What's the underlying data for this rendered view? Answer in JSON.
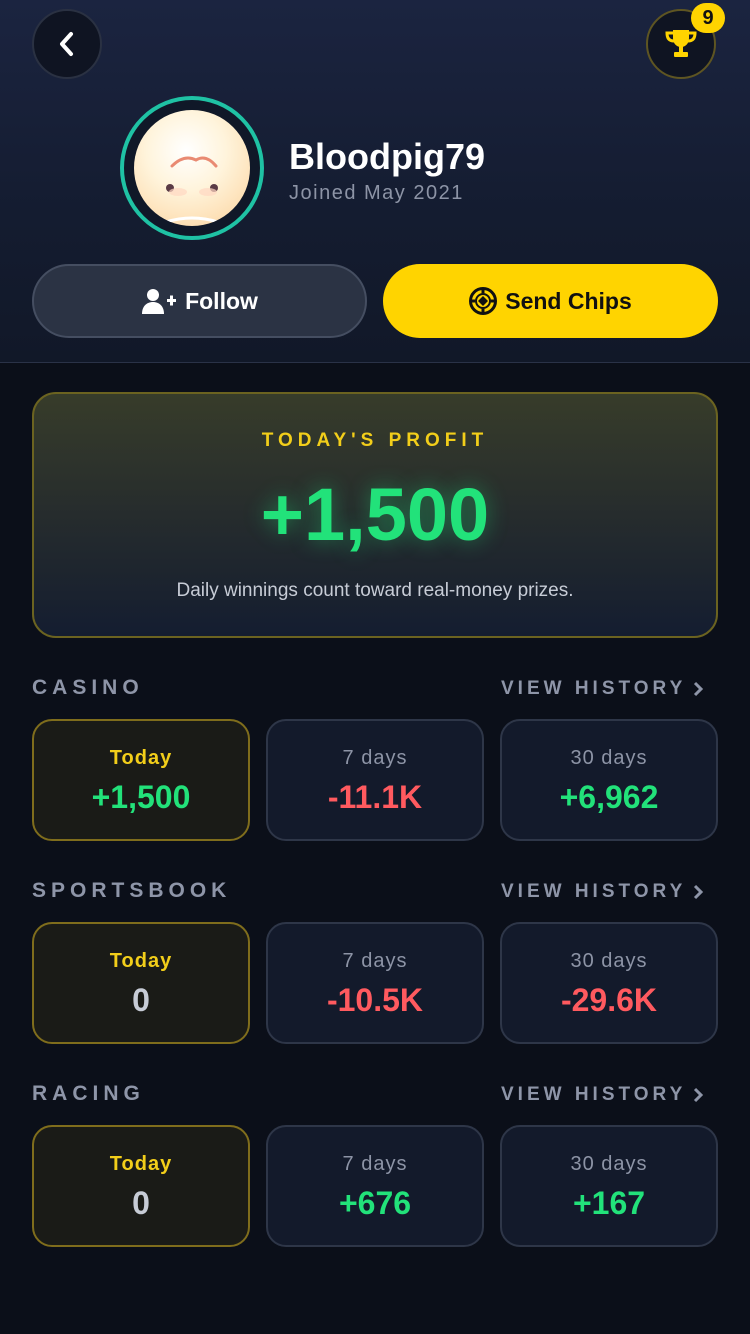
{
  "header": {
    "trophy_count": "9",
    "username": "Bloodpig79",
    "joined": "Joined May 2021",
    "follow_label": "Follow",
    "send_chips_label": "Send Chips"
  },
  "profit": {
    "label": "TODAY'S PROFIT",
    "value": "+1,500",
    "note": "Daily winnings count toward real-money prizes."
  },
  "sections": [
    {
      "title": "CASINO",
      "history_label": "VIEW HISTORY",
      "stats": [
        {
          "label": "Today",
          "value": "+1,500"
        },
        {
          "label": "7 days",
          "value": "-11.1K"
        },
        {
          "label": "30 days",
          "value": "+6,962"
        }
      ]
    },
    {
      "title": "SPORTSBOOK",
      "history_label": "VIEW HISTORY",
      "stats": [
        {
          "label": "Today",
          "value": "0"
        },
        {
          "label": "7 days",
          "value": "-10.5K"
        },
        {
          "label": "30 days",
          "value": "-29.6K"
        }
      ]
    },
    {
      "title": "RACING",
      "history_label": "VIEW HISTORY",
      "stats": [
        {
          "label": "Today",
          "value": "0"
        },
        {
          "label": "7 days",
          "value": "+676"
        },
        {
          "label": "30 days",
          "value": "+167"
        }
      ]
    }
  ],
  "colors": {
    "accent_yellow": "#ffd400",
    "positive": "#22e27a",
    "negative": "#ff5a5f",
    "avatar_ring": "#1fc2a4"
  }
}
